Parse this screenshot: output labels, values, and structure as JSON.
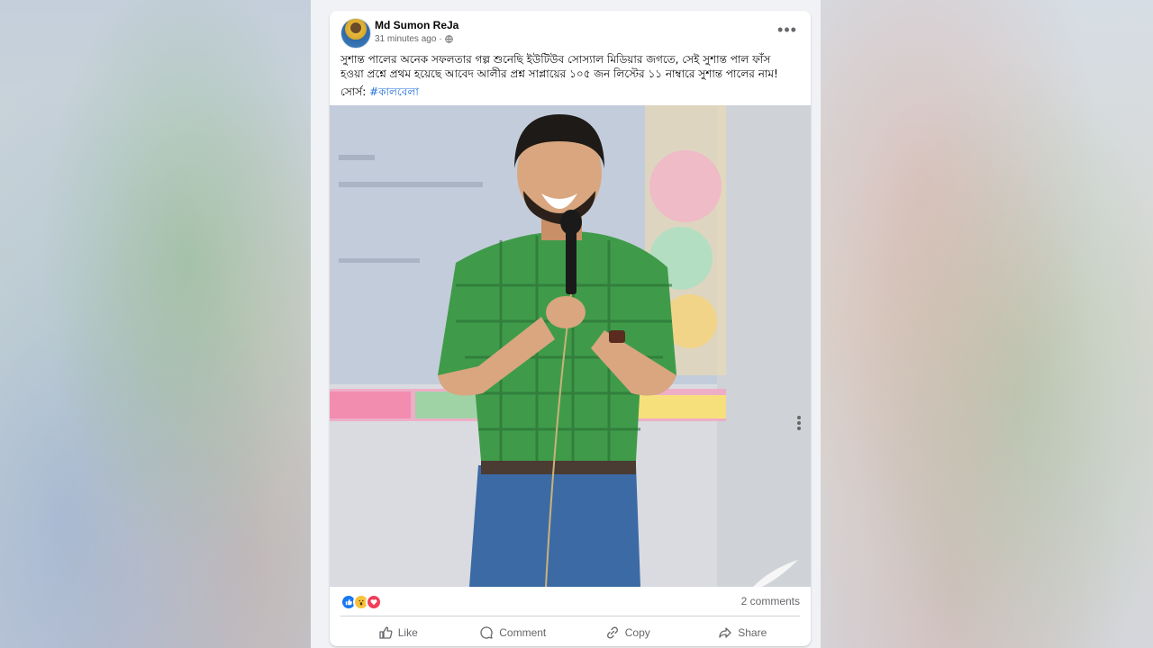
{
  "post": {
    "author": "Md Sumon ReJa",
    "time": "31 minutes ago",
    "visibility_icon": "globe-icon",
    "text": "সুশান্ত পালের অনেক সফলতার গল্প শুনেছি ইউটিউব সোস্যাল মিডিয়ার জগতে, সেই সুশান্ত পাল ফাঁস হওয়া প্রশ্নে প্রথম হয়েছে আবেদ আলীর প্রশ্ন সাপ্লায়ের ১০৫ জন লিস্টের ১১ নাম্বারে সুশান্ত পালের নাম!",
    "source_label": "সোর্স:",
    "source_tag": "#কালবেলা",
    "comments": "2 comments"
  },
  "reactions": [
    "like-icon",
    "wow-icon",
    "love-icon"
  ],
  "actions": {
    "like": "Like",
    "comment": "Comment",
    "copy": "Copy",
    "share": "Share"
  },
  "colors": {
    "link": "#216fdb",
    "like_blue": "#1877f2",
    "secondary_text": "#65676b"
  }
}
